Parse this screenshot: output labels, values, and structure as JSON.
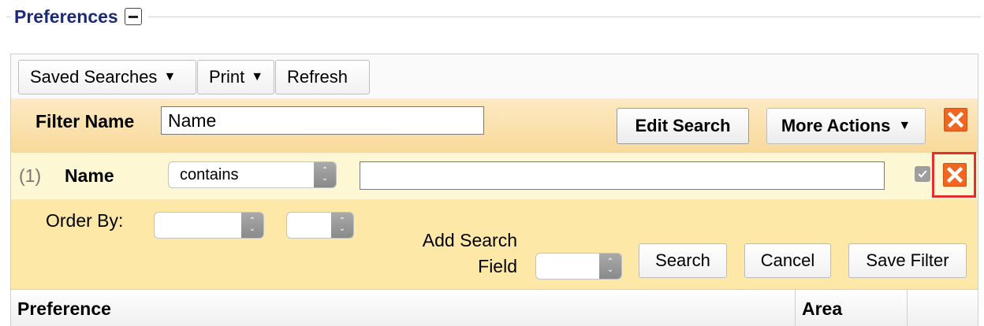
{
  "section": {
    "title": "Preferences"
  },
  "toolbar": {
    "saved_searches_label": "Saved Searches",
    "print_label": "Print",
    "refresh_label": "Refresh"
  },
  "filter": {
    "label": "Filter Name",
    "value": "Name",
    "edit_search_label": "Edit Search",
    "more_actions_label": "More Actions"
  },
  "criteria": {
    "index": "(1)",
    "field_name": "Name",
    "operator": "contains",
    "value": ""
  },
  "order": {
    "label": "Order By:",
    "add_search_field_line1": "Add Search",
    "add_search_field_line2": "Field",
    "search_label": "Search",
    "cancel_label": "Cancel",
    "save_filter_label": "Save Filter"
  },
  "table": {
    "columns": [
      "Preference",
      "Area",
      ""
    ]
  },
  "colors": {
    "accent_title": "#1b2a7a",
    "close_orange": "#f16722",
    "highlight_red": "#e3302f",
    "filter_bg": "#f8d99a",
    "criteria_bg": "#fdf7d4"
  },
  "icons": {
    "collapse": "minus-icon",
    "close": "close-icon",
    "dropdown": "caret-down-icon",
    "select": "select-arrows-icon",
    "check": "check-icon"
  }
}
